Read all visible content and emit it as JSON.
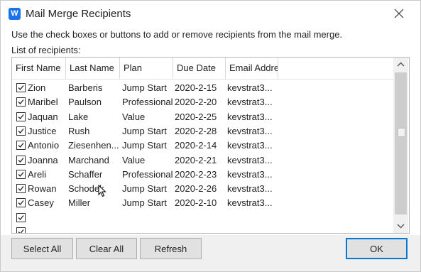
{
  "window": {
    "title": "Mail Merge Recipients",
    "icon": "wps-writer-icon",
    "accent": "#1a73e8"
  },
  "instructions": "Use the check boxes or buttons to add or remove recipients from the mail merge.",
  "list_label": "List of recipients:",
  "columns": [
    "First Name",
    "Last Name",
    "Plan",
    "Due Date",
    "Email Addre"
  ],
  "rows": [
    {
      "checked": true,
      "first": "Zion",
      "last": "Barberis",
      "plan": "Jump Start",
      "due": "2020-2-15",
      "email": "kevstrat3..."
    },
    {
      "checked": true,
      "first": "Maribel",
      "last": "Paulson",
      "plan": "Professional",
      "due": "2020-2-20",
      "email": "kevstrat3..."
    },
    {
      "checked": true,
      "first": "Jaquan",
      "last": "Lake",
      "plan": "Value",
      "due": "2020-2-25",
      "email": "kevstrat3..."
    },
    {
      "checked": true,
      "first": "Justice",
      "last": "Rush",
      "plan": "Jump Start",
      "due": "2020-2-28",
      "email": "kevstrat3..."
    },
    {
      "checked": true,
      "first": "Antonio",
      "last": "Ziesenhen...",
      "plan": "Jump Start",
      "due": "2020-2-14",
      "email": "kevstrat3..."
    },
    {
      "checked": true,
      "first": "Joanna",
      "last": "Marchand",
      "plan": "Value",
      "due": "2020-2-21",
      "email": "kevstrat3..."
    },
    {
      "checked": true,
      "first": "Areli",
      "last": "Schaffer",
      "plan": "Professional",
      "due": "2020-2-23",
      "email": "kevstrat3..."
    },
    {
      "checked": true,
      "first": "Rowan",
      "last": "Schodek",
      "plan": "Jump Start",
      "due": "2020-2-26",
      "email": "kevstrat3..."
    },
    {
      "checked": true,
      "first": "Casey",
      "last": "Miller",
      "plan": "Jump Start",
      "due": "2020-2-10",
      "email": "kevstrat3..."
    },
    {
      "checked": true,
      "first": "",
      "last": "",
      "plan": "",
      "due": "",
      "email": ""
    },
    {
      "checked": true,
      "first": "",
      "last": "",
      "plan": "",
      "due": "",
      "email": ""
    }
  ],
  "buttons": {
    "select_all": "Select All",
    "clear_all": "Clear All",
    "refresh": "Refresh",
    "ok": "OK"
  }
}
